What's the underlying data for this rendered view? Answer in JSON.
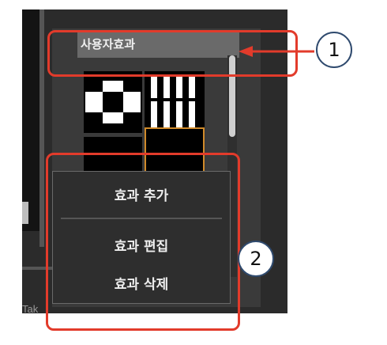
{
  "panel": {
    "header_label": "사용자효과"
  },
  "context_menu": {
    "items": [
      {
        "label": "효과 추가"
      },
      {
        "label": "효과 편집"
      },
      {
        "label": "효과 삭제"
      }
    ]
  },
  "background_fragment_text": "Tak",
  "annotations": {
    "callout_1": "1",
    "callout_2": "2"
  },
  "colors": {
    "callout_red": "#e23b2b",
    "selection_orange": "#d08a2a",
    "badge_border_blue": "#2f4a6e"
  }
}
